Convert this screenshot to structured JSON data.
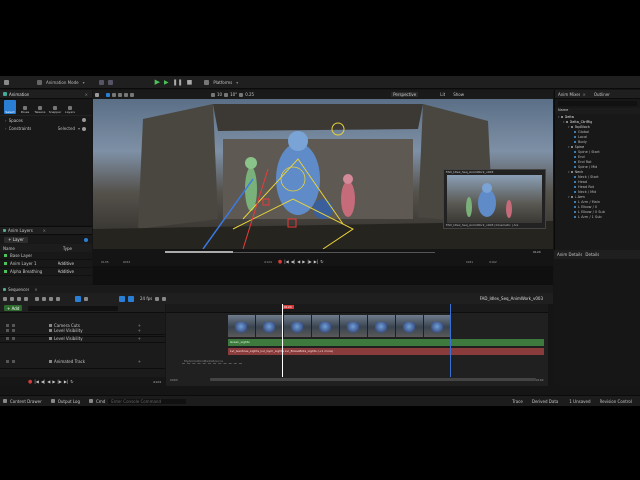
{
  "toolbar": {
    "mode_label": "Animation Mode",
    "platforms_label": "Platforms"
  },
  "animation_panel": {
    "title": "Animation",
    "tools": [
      "Select",
      "Poses",
      "Tweens",
      "Snapper",
      "Layers"
    ],
    "spaces_label": "Spaces",
    "constraints_label": "Constraints",
    "selected_label": "Selected"
  },
  "viewport": {
    "toolbar_values": [
      "10",
      "10°",
      "0.25"
    ],
    "perspective_label": "Perspective",
    "lit_label": "Lit",
    "show_label": "Show",
    "pip_label": "FAD_Idlex_Seq_AnimWork_v003",
    "pip_footer": "FAD_Idlex_Seq_AnimWork_v003 (Cinematic | Ani",
    "scrub_start": "0105",
    "scrub_start2": "0063",
    "scrub_current": "0124",
    "scrub_end": "0181",
    "scrub_end2": "0162",
    "fps_label": "24 fps",
    "top_right_num": "0124"
  },
  "anim_layers": {
    "title": "Anim Layers",
    "add_label": "+ Layer",
    "col_name": "Name",
    "col_type": "Type",
    "rows": [
      {
        "name": "Base Layer",
        "type": ""
      },
      {
        "name": "Anim Layer 1",
        "type": "Additive"
      },
      {
        "name": "Alpha Breathing",
        "type": "Additive"
      }
    ]
  },
  "sequencer": {
    "title": "Sequencer",
    "add_label": "+ Add",
    "fps_label": "24 fps",
    "sequence_name": "FAD_Idlex_Seq_AnimWork_v003",
    "current_frame": "0124",
    "frame_start": "0063",
    "frame_end": "0162",
    "tracks": [
      {
        "name": "Camera Cuts"
      },
      {
        "name": "Level Visibility"
      },
      {
        "name": "Level Visibility"
      },
      {
        "name": "Animated Track"
      }
    ],
    "clip_green_label": "Green_Lights",
    "clip_red_label": "Lvl_Gantries_Lights_Lvl_Gym_Lights Lvl_BoxesBots_Lights (+1 more)",
    "clip_gray_label": "MyAnimationMediaSource",
    "bottom_left": "0124",
    "bottom_right": "0162"
  },
  "outliner": {
    "title1": "Anim Mixer",
    "title2": "Outliner",
    "col_name": "Name",
    "items": [
      {
        "label": "Delta",
        "level": 0
      },
      {
        "label": "Delta_CtrlRig",
        "level": 1
      },
      {
        "label": "TopBlock",
        "level": 2
      },
      {
        "label": "Global",
        "level": 3
      },
      {
        "label": "Local",
        "level": 3
      },
      {
        "label": "Body",
        "level": 3
      },
      {
        "label": "Spine",
        "level": 2
      },
      {
        "label": "Spine / Start",
        "level": 3
      },
      {
        "label": "End",
        "level": 3
      },
      {
        "label": "End Rot",
        "level": 3
      },
      {
        "label": "Spine / Mid",
        "level": 3
      },
      {
        "label": "Neck",
        "level": 2
      },
      {
        "label": "Neck / Start",
        "level": 3
      },
      {
        "label": "Head",
        "level": 3
      },
      {
        "label": "Head Rot",
        "level": 3
      },
      {
        "label": "Neck / Mid",
        "level": 3
      },
      {
        "label": "L Arm",
        "level": 2
      },
      {
        "label": "L Arm / Main",
        "level": 3
      },
      {
        "label": "L Elbow / 0",
        "level": 3
      },
      {
        "label": "L Elbow / 0 Sub",
        "level": 3
      },
      {
        "label": "L Arm / 1 Sub",
        "level": 3
      }
    ],
    "details_tabs": [
      "Anim Details",
      "Details"
    ]
  },
  "status_bar": {
    "content_drawer": "Content Drawer",
    "output_log": "Output Log",
    "cmd": "Cmd",
    "console_placeholder": "Enter Console Command",
    "trace": "Trace",
    "derived_data": "Derived Data",
    "unsaved": "1 Unsaved",
    "revision_control": "Revision Control"
  },
  "colors": {
    "accent_blue": "#2a7fd4",
    "play_green": "#4cc25a",
    "record_red": "#d43a3a",
    "clip_green": "#3e7a3e",
    "clip_red": "#8a3c3c"
  }
}
